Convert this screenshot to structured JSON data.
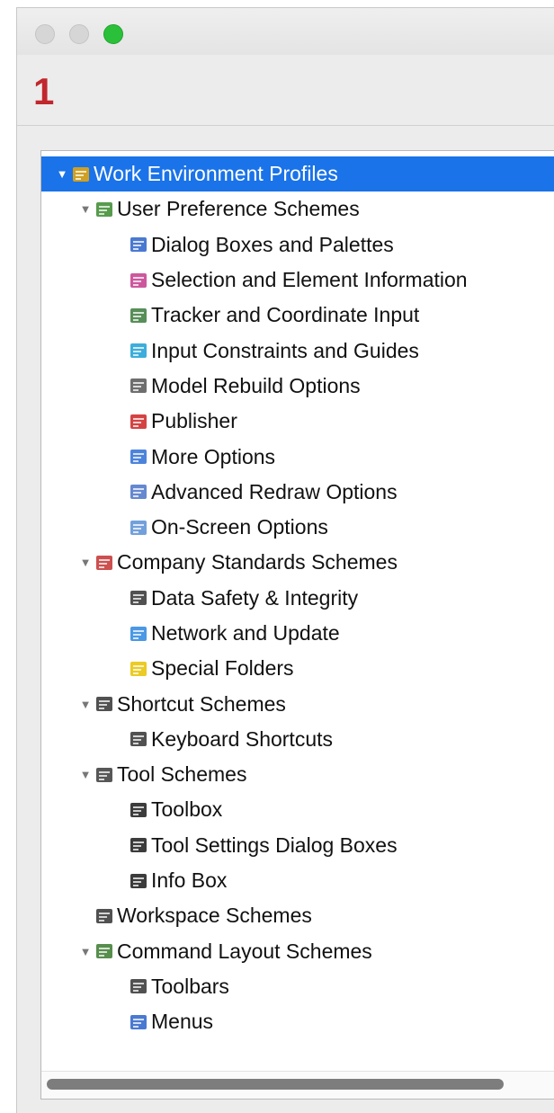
{
  "step_number": "1",
  "tree": [
    {
      "label": "Work Environment Profiles",
      "level": 0,
      "expanded": true,
      "selected": true,
      "icon": "profiles-icon",
      "color": "#f0a800"
    },
    {
      "label": "User Preference Schemes",
      "level": 1,
      "expanded": true,
      "icon": "user-schemes-icon",
      "color": "#3a8a2e"
    },
    {
      "label": "Dialog Boxes and Palettes",
      "level": 2,
      "icon": "dialog-boxes-icon",
      "color": "#2a62c9"
    },
    {
      "label": "Selection and Element Information",
      "level": 2,
      "icon": "selection-icon",
      "color": "#c43a8c"
    },
    {
      "label": "Tracker and Coordinate Input",
      "level": 2,
      "icon": "tracker-icon",
      "color": "#3b7a3b"
    },
    {
      "label": "Input Constraints and Guides",
      "level": 2,
      "icon": "constraints-icon",
      "color": "#1b9fd6"
    },
    {
      "label": "Model Rebuild Options",
      "level": 2,
      "icon": "model-rebuild-icon",
      "color": "#555555"
    },
    {
      "label": "Publisher",
      "level": 2,
      "icon": "publisher-icon",
      "color": "#cc2222"
    },
    {
      "label": "More Options",
      "level": 2,
      "icon": "more-options-icon",
      "color": "#2d6fd6"
    },
    {
      "label": "Advanced Redraw Options",
      "level": 2,
      "icon": "redraw-icon",
      "color": "#4a73c8"
    },
    {
      "label": "On-Screen Options",
      "level": 2,
      "icon": "on-screen-icon",
      "color": "#5a8fd6"
    },
    {
      "label": "Company Standards Schemes",
      "level": 1,
      "expanded": true,
      "icon": "company-schemes-icon",
      "color": "#c43030"
    },
    {
      "label": "Data Safety & Integrity",
      "level": 2,
      "icon": "data-safety-icon",
      "color": "#333333"
    },
    {
      "label": "Network and Update",
      "level": 2,
      "icon": "network-icon",
      "color": "#2b86e0"
    },
    {
      "label": "Special Folders",
      "level": 2,
      "icon": "folders-icon",
      "color": "#e8c200"
    },
    {
      "label": "Shortcut Schemes",
      "level": 1,
      "expanded": true,
      "icon": "shortcut-schemes-icon",
      "color": "#333333"
    },
    {
      "label": "Keyboard Shortcuts",
      "level": 2,
      "icon": "keyboard-shortcut-icon",
      "color": "#333333"
    },
    {
      "label": "Tool Schemes",
      "level": 1,
      "expanded": true,
      "icon": "tool-schemes-icon",
      "color": "#3a3a3a"
    },
    {
      "label": "Toolbox",
      "level": 2,
      "icon": "toolbox-icon",
      "color": "#1a1a1a"
    },
    {
      "label": "Tool Settings Dialog Boxes",
      "level": 2,
      "icon": "tool-settings-icon",
      "color": "#1a1a1a"
    },
    {
      "label": "Info Box",
      "level": 2,
      "icon": "info-box-icon",
      "color": "#1a1a1a"
    },
    {
      "label": "Workspace Schemes",
      "level": 1,
      "expanded": false,
      "icon": "workspace-schemes-icon",
      "color": "#333333"
    },
    {
      "label": "Command Layout Schemes",
      "level": 1,
      "expanded": true,
      "icon": "command-layout-icon",
      "color": "#3a7a2e"
    },
    {
      "label": "Toolbars",
      "level": 2,
      "icon": "toolbars-icon",
      "color": "#333333"
    },
    {
      "label": "Menus",
      "level": 2,
      "icon": "menus-icon",
      "color": "#2a62c9"
    }
  ],
  "scrollbar": {
    "thumb_fraction": 0.9
  }
}
